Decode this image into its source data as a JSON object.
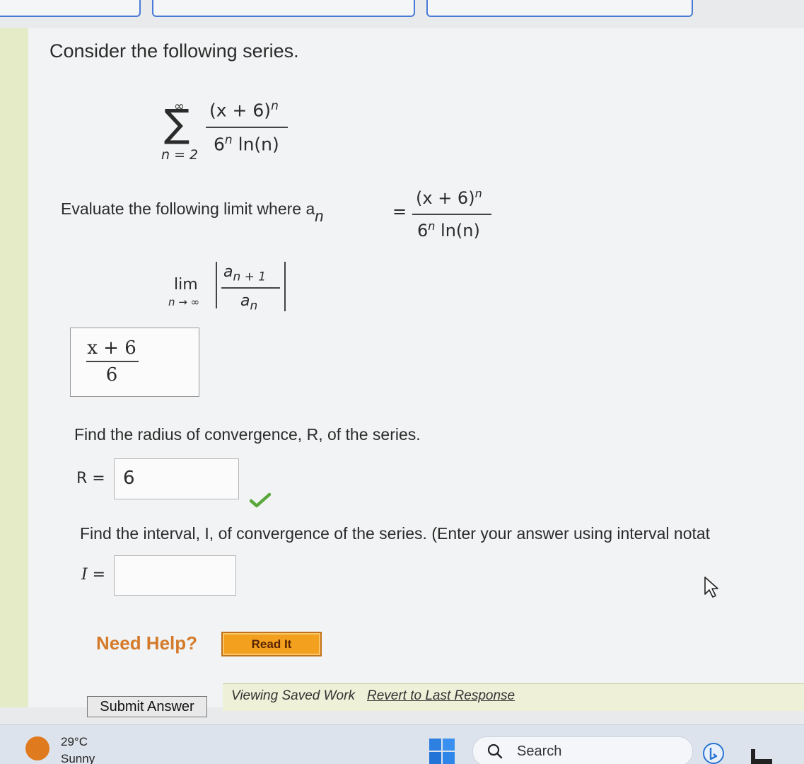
{
  "question": {
    "intro": "Consider the following series.",
    "series": {
      "sum_symbol": "∑",
      "upper": "∞",
      "lower": "n = 2",
      "numerator_base": "(x + 6)",
      "numerator_exp": "n",
      "denominator_base": "6",
      "denominator_exp": "n",
      "denominator_rest": " ln(n)"
    },
    "evaluate_text": "Evaluate the following limit where a",
    "an_sub": "n",
    "equals": "=",
    "limit": {
      "lim": "lim",
      "sub": "n → ∞",
      "num_a": "a",
      "num_sub": "n + 1",
      "den_a": "a",
      "den_sub": "n"
    },
    "limit_answer": {
      "numerator": "x + 6",
      "denominator": "6"
    },
    "radius_prompt": "Find the radius of convergence, R, of the series.",
    "radius_label": "R =",
    "radius_value": "6",
    "interval_prompt": "Find the interval, I, of convergence of the series. (Enter your answer using interval notat",
    "interval_label": "I =",
    "interval_value": ""
  },
  "help": {
    "label": "Need Help?",
    "read_it": "Read It"
  },
  "footer": {
    "submit": "Submit Answer",
    "viewing": "Viewing Saved Work",
    "revert": "Revert to Last Response"
  },
  "taskbar": {
    "temp": "29°C",
    "weather": "Sunny",
    "search": "Search"
  },
  "colors": {
    "accent_orange": "#f3a01f",
    "need_help": "#d47a2b",
    "check_green": "#5aa83c",
    "tab_blue": "#4a7ad8"
  }
}
